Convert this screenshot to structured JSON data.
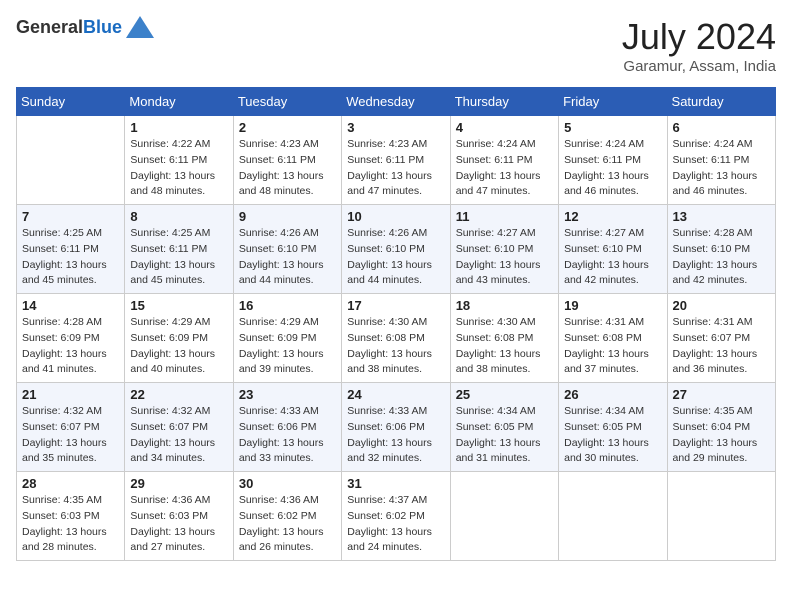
{
  "header": {
    "logo_general": "General",
    "logo_blue": "Blue",
    "month": "July 2024",
    "location": "Garamur, Assam, India"
  },
  "weekdays": [
    "Sunday",
    "Monday",
    "Tuesday",
    "Wednesday",
    "Thursday",
    "Friday",
    "Saturday"
  ],
  "weeks": [
    [
      {
        "day": "",
        "info": ""
      },
      {
        "day": "1",
        "info": "Sunrise: 4:22 AM\nSunset: 6:11 PM\nDaylight: 13 hours\nand 48 minutes."
      },
      {
        "day": "2",
        "info": "Sunrise: 4:23 AM\nSunset: 6:11 PM\nDaylight: 13 hours\nand 48 minutes."
      },
      {
        "day": "3",
        "info": "Sunrise: 4:23 AM\nSunset: 6:11 PM\nDaylight: 13 hours\nand 47 minutes."
      },
      {
        "day": "4",
        "info": "Sunrise: 4:24 AM\nSunset: 6:11 PM\nDaylight: 13 hours\nand 47 minutes."
      },
      {
        "day": "5",
        "info": "Sunrise: 4:24 AM\nSunset: 6:11 PM\nDaylight: 13 hours\nand 46 minutes."
      },
      {
        "day": "6",
        "info": "Sunrise: 4:24 AM\nSunset: 6:11 PM\nDaylight: 13 hours\nand 46 minutes."
      }
    ],
    [
      {
        "day": "7",
        "info": "Sunrise: 4:25 AM\nSunset: 6:11 PM\nDaylight: 13 hours\nand 45 minutes."
      },
      {
        "day": "8",
        "info": "Sunrise: 4:25 AM\nSunset: 6:11 PM\nDaylight: 13 hours\nand 45 minutes."
      },
      {
        "day": "9",
        "info": "Sunrise: 4:26 AM\nSunset: 6:10 PM\nDaylight: 13 hours\nand 44 minutes."
      },
      {
        "day": "10",
        "info": "Sunrise: 4:26 AM\nSunset: 6:10 PM\nDaylight: 13 hours\nand 44 minutes."
      },
      {
        "day": "11",
        "info": "Sunrise: 4:27 AM\nSunset: 6:10 PM\nDaylight: 13 hours\nand 43 minutes."
      },
      {
        "day": "12",
        "info": "Sunrise: 4:27 AM\nSunset: 6:10 PM\nDaylight: 13 hours\nand 42 minutes."
      },
      {
        "day": "13",
        "info": "Sunrise: 4:28 AM\nSunset: 6:10 PM\nDaylight: 13 hours\nand 42 minutes."
      }
    ],
    [
      {
        "day": "14",
        "info": "Sunrise: 4:28 AM\nSunset: 6:09 PM\nDaylight: 13 hours\nand 41 minutes."
      },
      {
        "day": "15",
        "info": "Sunrise: 4:29 AM\nSunset: 6:09 PM\nDaylight: 13 hours\nand 40 minutes."
      },
      {
        "day": "16",
        "info": "Sunrise: 4:29 AM\nSunset: 6:09 PM\nDaylight: 13 hours\nand 39 minutes."
      },
      {
        "day": "17",
        "info": "Sunrise: 4:30 AM\nSunset: 6:08 PM\nDaylight: 13 hours\nand 38 minutes."
      },
      {
        "day": "18",
        "info": "Sunrise: 4:30 AM\nSunset: 6:08 PM\nDaylight: 13 hours\nand 38 minutes."
      },
      {
        "day": "19",
        "info": "Sunrise: 4:31 AM\nSunset: 6:08 PM\nDaylight: 13 hours\nand 37 minutes."
      },
      {
        "day": "20",
        "info": "Sunrise: 4:31 AM\nSunset: 6:07 PM\nDaylight: 13 hours\nand 36 minutes."
      }
    ],
    [
      {
        "day": "21",
        "info": "Sunrise: 4:32 AM\nSunset: 6:07 PM\nDaylight: 13 hours\nand 35 minutes."
      },
      {
        "day": "22",
        "info": "Sunrise: 4:32 AM\nSunset: 6:07 PM\nDaylight: 13 hours\nand 34 minutes."
      },
      {
        "day": "23",
        "info": "Sunrise: 4:33 AM\nSunset: 6:06 PM\nDaylight: 13 hours\nand 33 minutes."
      },
      {
        "day": "24",
        "info": "Sunrise: 4:33 AM\nSunset: 6:06 PM\nDaylight: 13 hours\nand 32 minutes."
      },
      {
        "day": "25",
        "info": "Sunrise: 4:34 AM\nSunset: 6:05 PM\nDaylight: 13 hours\nand 31 minutes."
      },
      {
        "day": "26",
        "info": "Sunrise: 4:34 AM\nSunset: 6:05 PM\nDaylight: 13 hours\nand 30 minutes."
      },
      {
        "day": "27",
        "info": "Sunrise: 4:35 AM\nSunset: 6:04 PM\nDaylight: 13 hours\nand 29 minutes."
      }
    ],
    [
      {
        "day": "28",
        "info": "Sunrise: 4:35 AM\nSunset: 6:03 PM\nDaylight: 13 hours\nand 28 minutes."
      },
      {
        "day": "29",
        "info": "Sunrise: 4:36 AM\nSunset: 6:03 PM\nDaylight: 13 hours\nand 27 minutes."
      },
      {
        "day": "30",
        "info": "Sunrise: 4:36 AM\nSunset: 6:02 PM\nDaylight: 13 hours\nand 26 minutes."
      },
      {
        "day": "31",
        "info": "Sunrise: 4:37 AM\nSunset: 6:02 PM\nDaylight: 13 hours\nand 24 minutes."
      },
      {
        "day": "",
        "info": ""
      },
      {
        "day": "",
        "info": ""
      },
      {
        "day": "",
        "info": ""
      }
    ]
  ]
}
